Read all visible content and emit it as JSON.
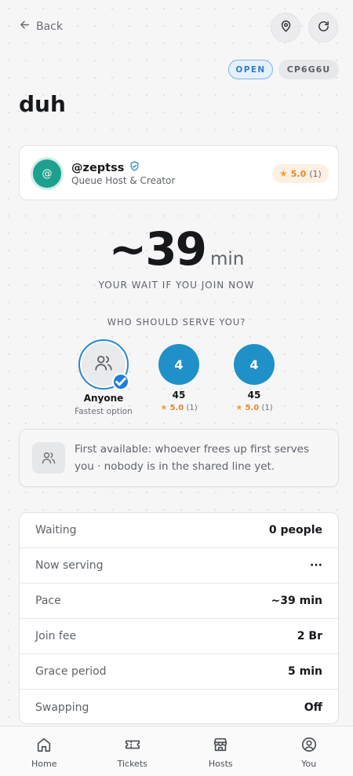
{
  "header": {
    "back_label": "Back"
  },
  "status": {
    "open_label": "OPEN",
    "code": "CP6G6U"
  },
  "queue": {
    "title": "duh"
  },
  "host": {
    "avatar_text": "@",
    "name": "@zeptss",
    "role": "Queue Host & Creator",
    "rating": "5.0",
    "rating_count": "(1)"
  },
  "wait": {
    "value": "~39",
    "unit": "min",
    "caption": "YOUR WAIT IF YOU JOIN NOW"
  },
  "servers": {
    "caption": "WHO SHOULD SERVE YOU?",
    "anyone": {
      "name": "Anyone",
      "sub": "Fastest option"
    },
    "items": [
      {
        "initial": "4",
        "name": "45",
        "rating": "5.0",
        "rating_count": "(1)"
      },
      {
        "initial": "4",
        "name": "45",
        "rating": "5.0",
        "rating_count": "(1)"
      }
    ]
  },
  "info": {
    "text": "First available: whoever frees up first serves you · nobody is in the shared line yet."
  },
  "stats": [
    {
      "label": "Waiting",
      "value": "0 people"
    },
    {
      "label": "Now serving",
      "value": "···"
    },
    {
      "label": "Pace",
      "value": "~39 min"
    },
    {
      "label": "Join fee",
      "value": "2 Br"
    },
    {
      "label": "Grace period",
      "value": "5 min"
    },
    {
      "label": "Swapping",
      "value": "Off"
    }
  ],
  "nav": [
    {
      "label": "Home",
      "icon": "home-icon"
    },
    {
      "label": "Tickets",
      "icon": "ticket-icon"
    },
    {
      "label": "Hosts",
      "icon": "store-icon"
    },
    {
      "label": "You",
      "icon": "user-icon"
    }
  ],
  "colors": {
    "accent": "#1f91c8",
    "open": "#2f7fc9",
    "star": "#f0a23a",
    "avatar": "#1ea08f"
  }
}
